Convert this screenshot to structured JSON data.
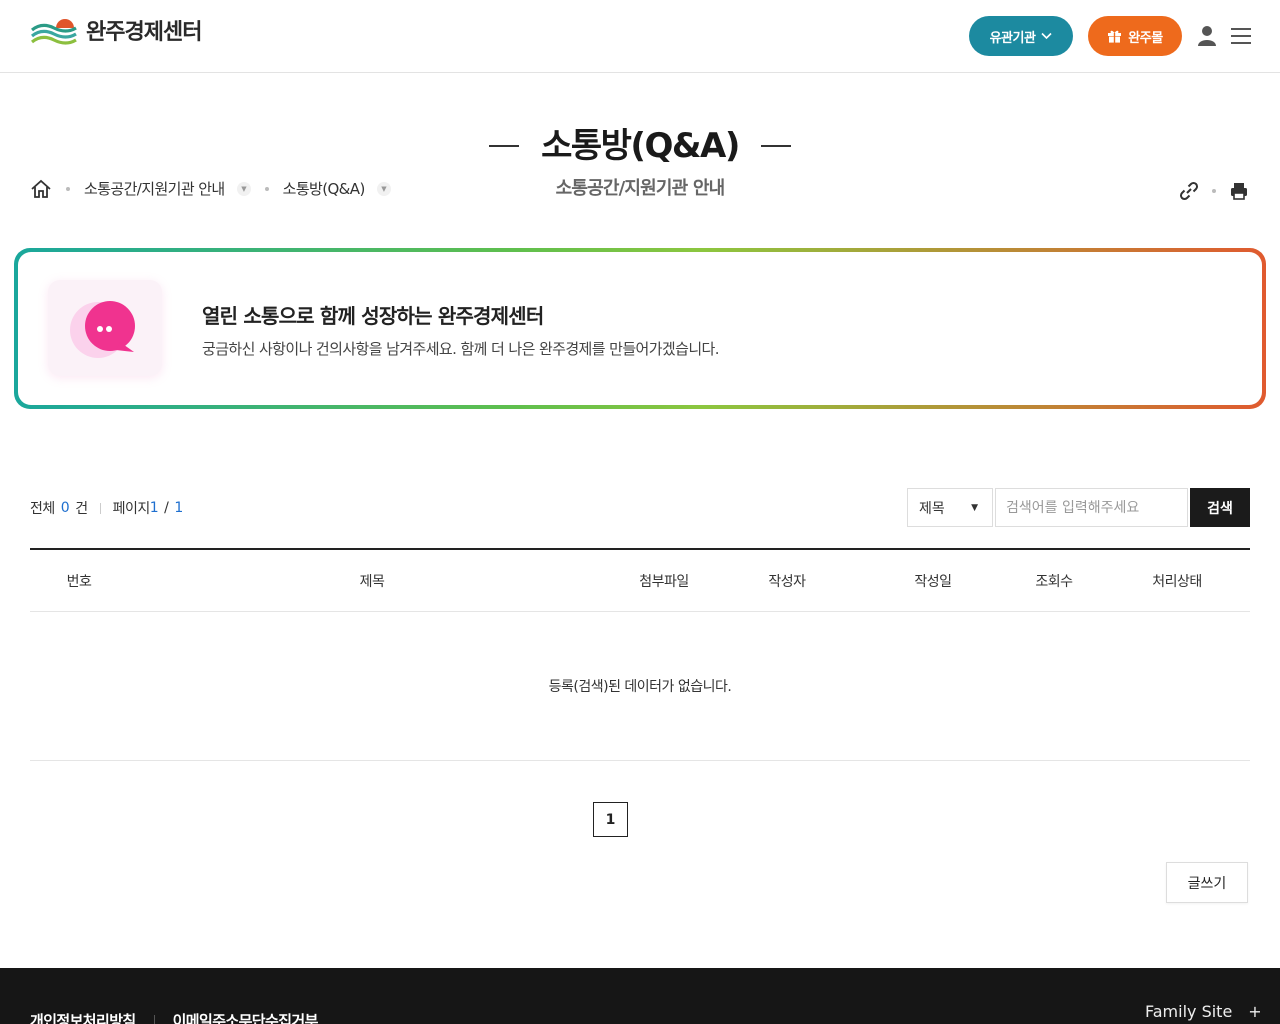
{
  "header": {
    "logo_text": "완주경제센터",
    "org_button": "유관기관",
    "mall_button": "완주몰"
  },
  "page": {
    "title": "소통방(Q&A)",
    "subtitle": "소통공간/지원기관 안내"
  },
  "breadcrumb": {
    "items": [
      "소통공간/지원기관 안내",
      "소통방(Q&A)"
    ]
  },
  "banner": {
    "heading": "열린 소통으로 함께 성장하는 완주경제센터",
    "text": "궁금하신 사항이나 건의사항을 남겨주세요. 함께 더 나은 완주경제를 만들어가겠습니다."
  },
  "list_info": {
    "total_label": "전체",
    "total_count": "0",
    "total_unit": "건",
    "page_label": "페이지",
    "page_current": "1",
    "page_sep": "/",
    "page_total": "1"
  },
  "search": {
    "field_selected": "제목",
    "placeholder": "검색어를 입력해주세요",
    "button": "검색"
  },
  "table": {
    "columns": [
      "번호",
      "제목",
      "첨부파일",
      "작성자",
      "작성일",
      "조회수",
      "처리상태"
    ],
    "empty_message": "등록(검색)된 데이터가 없습니다."
  },
  "pagination": {
    "current": "1"
  },
  "write_button": "글쓰기",
  "footer": {
    "links": [
      "개인정보처리방침",
      "이메일주소무단수집거부"
    ],
    "family_site": "Family Site",
    "family_plus": "+"
  },
  "colors": {
    "org_button": "#1c8aa0",
    "mall_button": "#ee6a1c",
    "accent_number": "#1e6fcf",
    "footer_bg": "#161616"
  }
}
